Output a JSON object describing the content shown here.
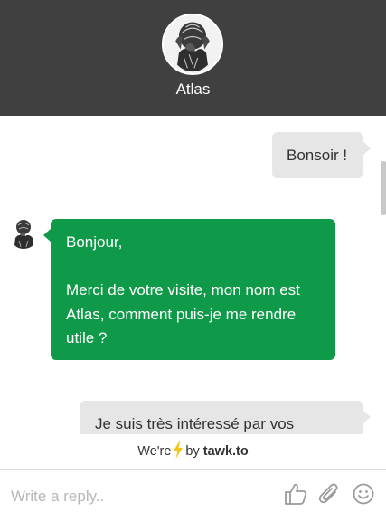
{
  "header": {
    "agent_name": "Atlas",
    "avatar_icon": "atlas-statue-avatar"
  },
  "messages": [
    {
      "sender": "visitor",
      "lines": [
        "Bonsoir !"
      ]
    },
    {
      "sender": "agent",
      "lines": [
        "Bonjour,",
        "",
        "Merci de votre visite, mon nom est",
        "Atlas, comment puis-je me rendre",
        "utile ?"
      ]
    },
    {
      "sender": "visitor",
      "lines": [
        "Je suis très intéressé par vos"
      ]
    }
  ],
  "branding": {
    "prefix": "We're",
    "icon": "lightning-bolt-icon",
    "by": "by",
    "brand": "tawk.to"
  },
  "composer": {
    "placeholder": "Write a reply..",
    "icons": [
      "thumbs-up-icon",
      "paperclip-icon",
      "smiley-icon"
    ]
  },
  "colors": {
    "header_bg": "#404040",
    "agent_bubble": "#0f9a49",
    "visitor_bubble": "#e6e6e6",
    "bolt": "#f5c518"
  }
}
